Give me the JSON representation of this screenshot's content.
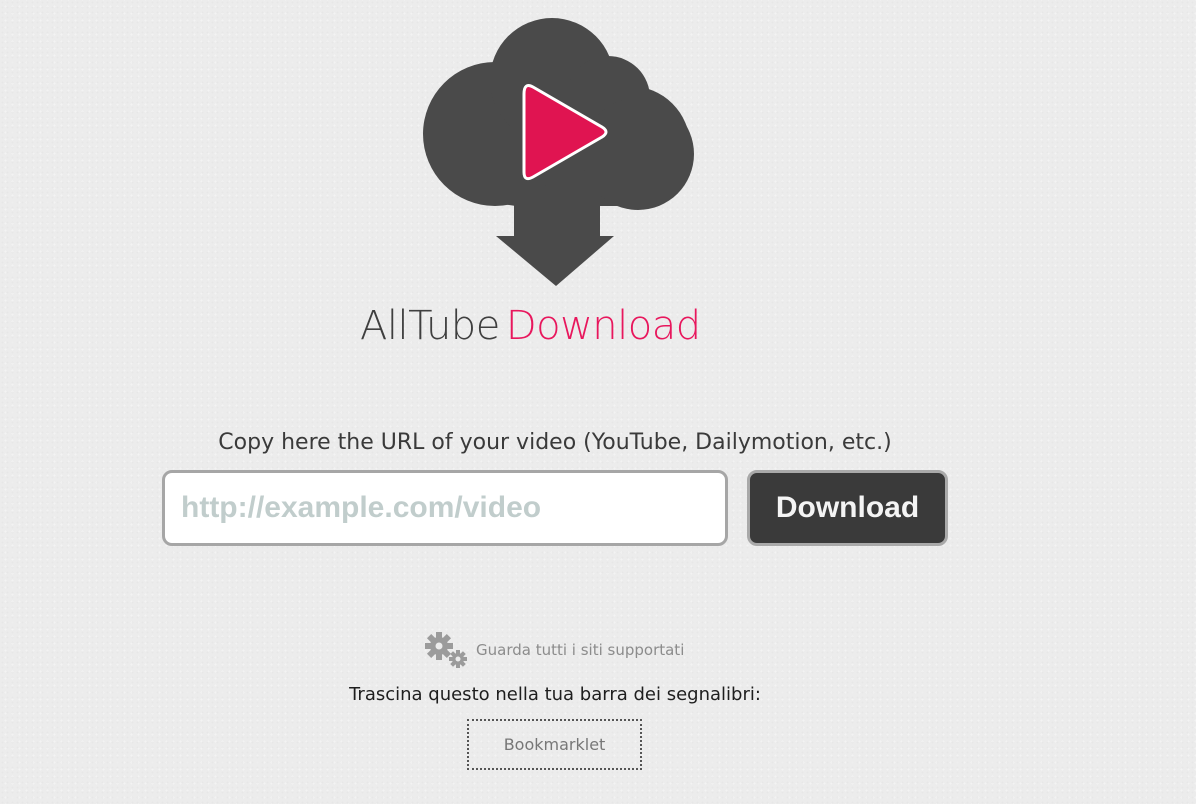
{
  "brand": {
    "part1": "AllTube",
    "part2": "Download",
    "logo_icon": "cloud-play-download-icon",
    "colors": {
      "cloud": "#4a4a4a",
      "accent": "#e8175d"
    }
  },
  "form": {
    "prompt": "Copy here the URL of your video (YouTube, Dailymotion, etc.)",
    "url_placeholder": "http://example.com/video",
    "url_value": "",
    "download_label": "Download"
  },
  "footer": {
    "supported_icon": "gears-icon",
    "supported_label": "Guarda tutti i siti supportati",
    "drag_hint": "Trascina questo nella tua barra dei segnalibri:",
    "bookmarklet_label": "Bookmarklet"
  }
}
